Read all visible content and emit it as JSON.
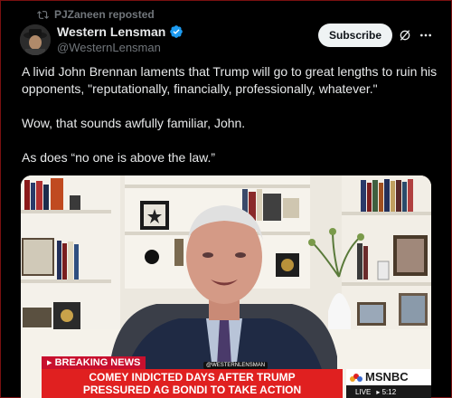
{
  "repost": {
    "text": "PJZaneen reposted",
    "icon": "repost-icon"
  },
  "author": {
    "name": "Western Lensman",
    "handle": "@WesternLensman",
    "verified": true,
    "avatar_icon": "avatar"
  },
  "actions": {
    "subscribe_label": "Subscribe",
    "grok_icon": "grok-icon",
    "more_icon": "more-icon"
  },
  "tweet": {
    "line1": "A livid John Brennan laments that Trump will go to great lengths to ruin his opponents, \"reputationally, financially, professionally, whatever.\"",
    "line2": "Wow, that sounds awfully familiar, John.",
    "line3": "As does “no one is above the law.”"
  },
  "media": {
    "watermark": "@WESTERNLENSMAN",
    "breaking": "▸ BREAKING NEWS",
    "headline_1": "COMEY INDICTED DAYS AFTER TRUMP",
    "headline_2": "PRESSURED AG BONDI TO TAKE ACTION",
    "network": "MSNBC",
    "live": "LIVE",
    "time": "▸ 5:12"
  },
  "colors": {
    "accent_red": "#e02020",
    "verified_blue": "#1d9bf0",
    "muted": "#71767b"
  }
}
